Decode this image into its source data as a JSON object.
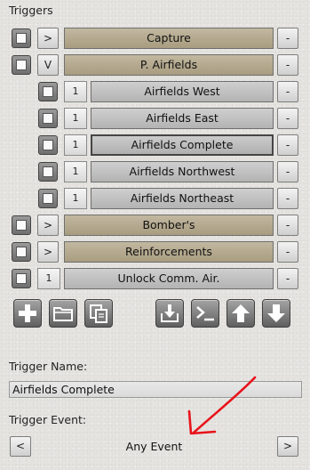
{
  "panel": {
    "title": "Triggers"
  },
  "triggers": {
    "capture": {
      "toggle": ">",
      "label": "Capture",
      "remove": "-"
    },
    "p_airfields": {
      "toggle": "V",
      "label": "P. Airfields",
      "remove": "-"
    },
    "airfields_west": {
      "count": "1",
      "label": "Airfields West",
      "remove": "-"
    },
    "airfields_east": {
      "count": "1",
      "label": "Airfields East",
      "remove": "-"
    },
    "airfields_complete": {
      "count": "1",
      "label": "Airfields Complete",
      "remove": "-"
    },
    "airfields_northwest": {
      "count": "1",
      "label": "Airfields Northwest",
      "remove": "-"
    },
    "airfields_northeast": {
      "count": "1",
      "label": "Airfields Northeast",
      "remove": "-"
    },
    "bombers": {
      "toggle": ">",
      "label": "Bomber's",
      "remove": "-"
    },
    "reinforcements": {
      "toggle": ">",
      "label": "Reinforcements",
      "remove": "-"
    },
    "unlock_comm_air": {
      "count": "1",
      "label": "Unlock Comm. Air.",
      "remove": "-"
    }
  },
  "toolbar": {
    "icons": [
      "add-icon",
      "folder-icon",
      "copy-icon",
      "import-icon",
      "script-icon",
      "move-up-icon",
      "move-down-icon"
    ]
  },
  "trigger_name": {
    "label": "Trigger Name:",
    "value": "Airfields Complete"
  },
  "trigger_event": {
    "label": "Trigger Event:",
    "value": "Any Event",
    "prev": "<",
    "next": ">"
  },
  "colors": {
    "group_bar": "#b5aa90",
    "trigger_bar": "#c1c1c1",
    "annotation_arrow": "#e8121b"
  }
}
